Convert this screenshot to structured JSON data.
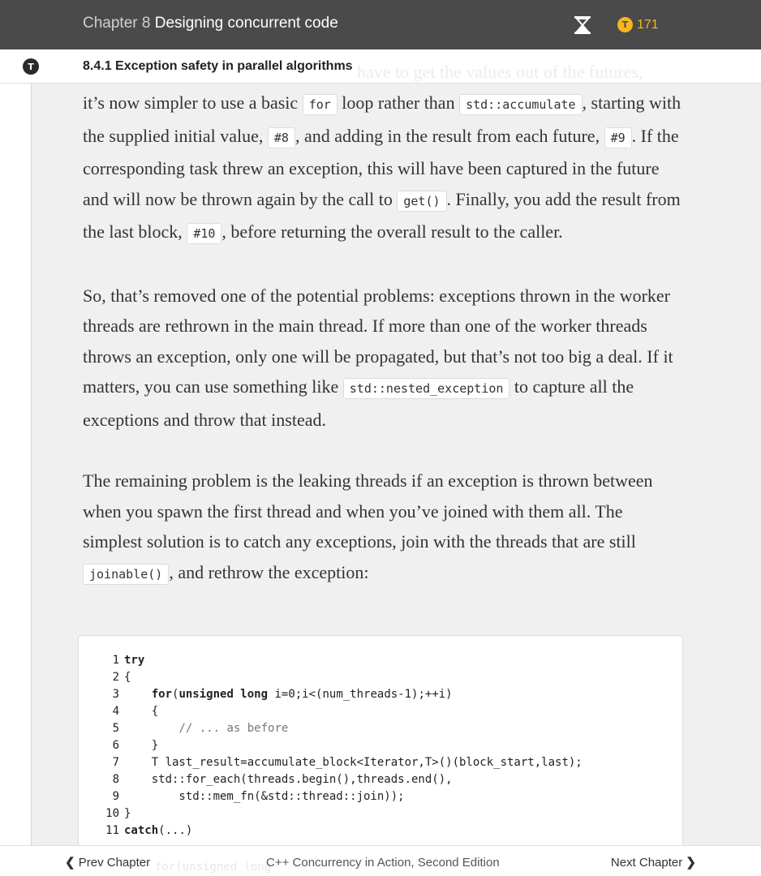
{
  "header": {
    "chapter_prefix": "Chapter 8",
    "chapter_title": "Designing concurrent code",
    "token_count": "171",
    "token_icon_letter": "T",
    "hourglass_icon": "hourglass-icon"
  },
  "sidebar": {
    "logo_letter": "T"
  },
  "section": {
    "title": "8.4.1  Exception safety in parallel algorithms",
    "ghost_text": "have to get the values out of the futures,"
  },
  "content": {
    "p1": {
      "t1": "it’s now simpler to use a basic ",
      "c1": "for",
      "t2": " loop rather than ",
      "c2": "std::accumulate",
      "t3": ", starting with the supplied initial value, ",
      "c3": "#8",
      "t4": ", and adding in the result from each future, ",
      "c4": "#9",
      "t5": ". If the corresponding task threw an exception, this will have been captured in the future and will now be thrown again by the call to ",
      "c5": "get()",
      "t6": ". Finally, you add the result from the last block, ",
      "c6": "#10",
      "t7": ", before returning the overall result to the caller."
    },
    "p2": {
      "t1": "So, that’s removed one of the potential problems: exceptions thrown in the worker threads are rethrown in the main thread. If more than one of the worker threads throws an exception, only one will be propagated, but that’s not too big a deal. If it matters, you can use something like ",
      "c1": "std::nested_exception",
      "t2": " to capture all the exceptions and throw that instead."
    },
    "p3": {
      "t1": "The remaining problem is the leaking threads if an exception is thrown between when you spawn the first thread and when you’ve joined with them all. The simplest solution is to catch any exceptions, join with the threads that are still ",
      "c1": "joinable()",
      "t2": ", and rethrow the exception:"
    }
  },
  "code": {
    "lines": [
      {
        "n": "1",
        "parts": [
          {
            "t": "try",
            "k": true
          }
        ]
      },
      {
        "n": "2",
        "parts": [
          {
            "t": "{"
          }
        ]
      },
      {
        "n": "3",
        "parts": [
          {
            "t": "    "
          },
          {
            "t": "for",
            "k": true
          },
          {
            "t": "("
          },
          {
            "t": "unsigned long",
            "k": true
          },
          {
            "t": " i=0;i<(num_threads-1);++i)"
          }
        ]
      },
      {
        "n": "4",
        "parts": [
          {
            "t": "    {"
          }
        ]
      },
      {
        "n": "5",
        "parts": [
          {
            "t": "        "
          },
          {
            "t": "// ... as before",
            "c": true
          }
        ]
      },
      {
        "n": "6",
        "parts": [
          {
            "t": "    }"
          }
        ]
      },
      {
        "n": "7",
        "parts": [
          {
            "t": "    T last_result=accumulate_block<Iterator,T>()(block_start,last);"
          }
        ]
      },
      {
        "n": "8",
        "parts": [
          {
            "t": "    std::for_each(threads.begin(),threads.end(),"
          }
        ]
      },
      {
        "n": "9",
        "parts": [
          {
            "t": "        std::mem_fn(&std::thread::join));"
          }
        ]
      },
      {
        "n": "10",
        "parts": [
          {
            "t": "}"
          }
        ]
      },
      {
        "n": "11",
        "parts": [
          {
            "t": "catch",
            "k": true
          },
          {
            "t": "(...)"
          }
        ]
      }
    ]
  },
  "footer": {
    "prev_label": "Prev Chapter",
    "book_title": "C++ Concurrency in Action, Second Edition",
    "next_label": "Next Chapter",
    "ghost_code": "for(unsigned long"
  }
}
